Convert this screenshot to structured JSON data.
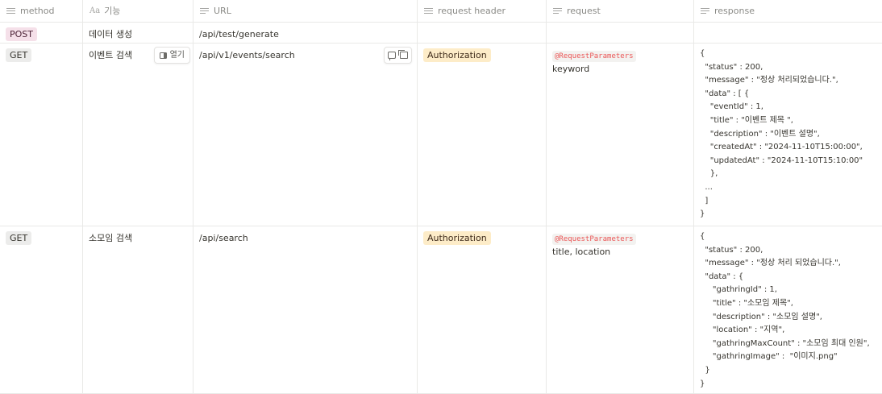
{
  "columns": [
    {
      "label": "method",
      "icon": "list-icon"
    },
    {
      "label": "기능",
      "icon": "title-aa-icon",
      "icon_text": "Aa"
    },
    {
      "label": "URL",
      "icon": "text-icon"
    },
    {
      "label": "request header",
      "icon": "list-icon"
    },
    {
      "label": "request",
      "icon": "text-icon"
    },
    {
      "label": "response",
      "icon": "text-icon"
    }
  ],
  "rows": [
    {
      "method": "POST",
      "feature": "데이터 생성",
      "url": "/api/test/generate",
      "header": "",
      "request_tag": "",
      "request_text": "",
      "response": ""
    },
    {
      "method": "GET",
      "feature": "이벤트 검색",
      "open_label": "열기",
      "url": "/api/v1/events/search",
      "header": "Authorization",
      "request_tag": "@RequestParameters",
      "request_text": "keyword",
      "response": "{\n  \"status\" : 200,\n  \"message\" : \"정상 처리되었습니다.\",\n  \"data\" : [ {\n    \"eventId\" : 1,\n    \"title\" : \"이벤트 제목 \",\n    \"description\" : \"이벤트 설명\",\n    \"createdAt\" : \"2024-11-10T15:00:00\",\n    \"updatedAt\" : \"2024-11-10T15:10:00\"\n    },\n  ...\n  ]\n}"
    },
    {
      "method": "GET",
      "feature": "소모임 검색",
      "url": "/api/search",
      "header": "Authorization",
      "request_tag": "@RequestParameters",
      "request_text": "title, location",
      "response": "{\n  \"status\" : 200,\n  \"message\" : \"정상 처리 되었습니다.\",\n  \"data\" : {\n     \"gathringId\" : 1,\n     \"title\" : \"소모임 제목\",\n     \"description\" : \"소모임 설명\",\n     \"location\" : \"지역\",\n     \"gathringMaxCount\" : \"소모임 최대 인원\",\n     \"gathringImage\" :  \"이미지.png\"\n  }\n}"
    }
  ],
  "colors": {
    "post_tag_bg": "#f5e0e9",
    "get_tag_bg": "#ececeb",
    "auth_tag_bg": "#fdecc8",
    "code_text": "#eb5757",
    "border": "#e9e9e7"
  }
}
